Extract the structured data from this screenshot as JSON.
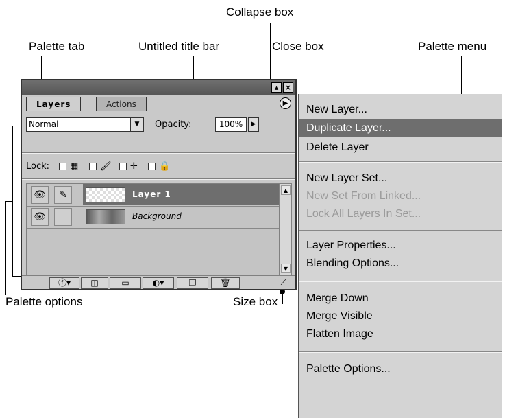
{
  "callouts": {
    "collapse_box": "Collapse box",
    "palette_tab": "Palette tab",
    "untitled_title_bar": "Untitled title bar",
    "close_box": "Close box",
    "palette_menu": "Palette menu",
    "palette_options": "Palette options",
    "size_box": "Size box"
  },
  "palette": {
    "tabs": [
      {
        "label": "Layers",
        "active": true
      },
      {
        "label": "Actions",
        "active": false
      }
    ],
    "blend_mode": "Normal",
    "opacity_label": "Opacity:",
    "opacity_value": "100%",
    "lock_label": "Lock:",
    "layers": [
      {
        "name": "Layer 1",
        "selected": true,
        "visible": true,
        "brush": true
      },
      {
        "name": "Background",
        "selected": false,
        "visible": true,
        "brush": false
      }
    ],
    "bottom_buttons": [
      "layer-style-icon",
      "add-mask-icon",
      "layer-set-icon",
      "adjustment-layer-icon",
      "new-layer-icon",
      "trash-icon"
    ]
  },
  "menu": {
    "groups": [
      [
        {
          "label": "New Layer...",
          "highlighted": false,
          "disabled": false
        },
        {
          "label": "Duplicate Layer...",
          "highlighted": true,
          "disabled": false
        },
        {
          "label": "Delete Layer",
          "highlighted": false,
          "disabled": false
        }
      ],
      [
        {
          "label": "New Layer Set...",
          "highlighted": false,
          "disabled": false
        },
        {
          "label": "New Set From Linked...",
          "highlighted": false,
          "disabled": true
        },
        {
          "label": "Lock All Layers In Set...",
          "highlighted": false,
          "disabled": true
        }
      ],
      [
        {
          "label": "Layer Properties...",
          "highlighted": false,
          "disabled": false
        },
        {
          "label": "Blending Options...",
          "highlighted": false,
          "disabled": false
        }
      ],
      [
        {
          "label": "Merge Down",
          "highlighted": false,
          "disabled": false
        },
        {
          "label": "Merge Visible",
          "highlighted": false,
          "disabled": false
        },
        {
          "label": "Flatten Image",
          "highlighted": false,
          "disabled": false
        }
      ],
      [
        {
          "label": "Palette Options...",
          "highlighted": false,
          "disabled": false
        }
      ]
    ]
  },
  "colors": {
    "title_bar": "#5f5f5f",
    "selected_layer": "#6e6e6e",
    "menu_highlight": "#6e6e6e"
  }
}
